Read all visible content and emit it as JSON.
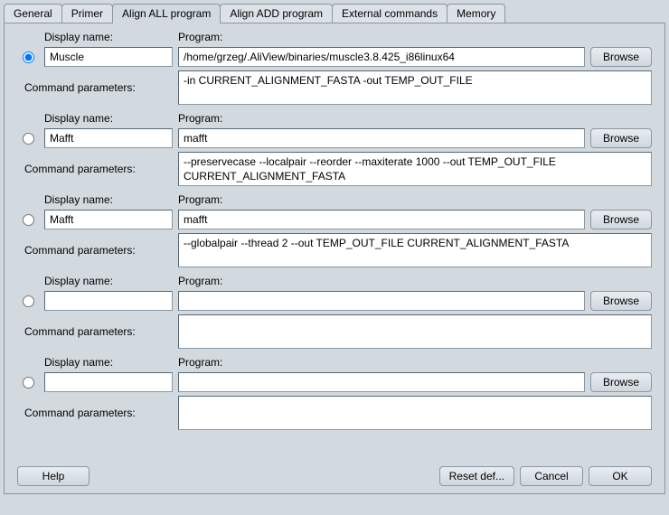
{
  "tabs": [
    "General",
    "Primer",
    "Align ALL program",
    "Align ADD program",
    "External commands",
    "Memory"
  ],
  "active_tab": 2,
  "labels": {
    "display_name": "Display name:",
    "program": "Program:",
    "command_params": "Command parameters:",
    "browse": "Browse",
    "help": "Help",
    "reset": "Reset def...",
    "cancel": "Cancel",
    "ok": "OK"
  },
  "entries": [
    {
      "selected": true,
      "display": "Muscle",
      "program": "/home/grzeg/.AliView/binaries/muscle3.8.425_i86linux64",
      "params": "-in CURRENT_ALIGNMENT_FASTA -out TEMP_OUT_FILE"
    },
    {
      "selected": false,
      "display": "Mafft",
      "program": "mafft",
      "params": "--preservecase --localpair --reorder --maxiterate 1000 --out TEMP_OUT_FILE CURRENT_ALIGNMENT_FASTA"
    },
    {
      "selected": false,
      "display": "Mafft",
      "program": "mafft",
      "params": "--globalpair --thread 2 --out TEMP_OUT_FILE CURRENT_ALIGNMENT_FASTA"
    },
    {
      "selected": false,
      "display": "",
      "program": "",
      "params": ""
    },
    {
      "selected": false,
      "display": "",
      "program": "",
      "params": ""
    }
  ]
}
